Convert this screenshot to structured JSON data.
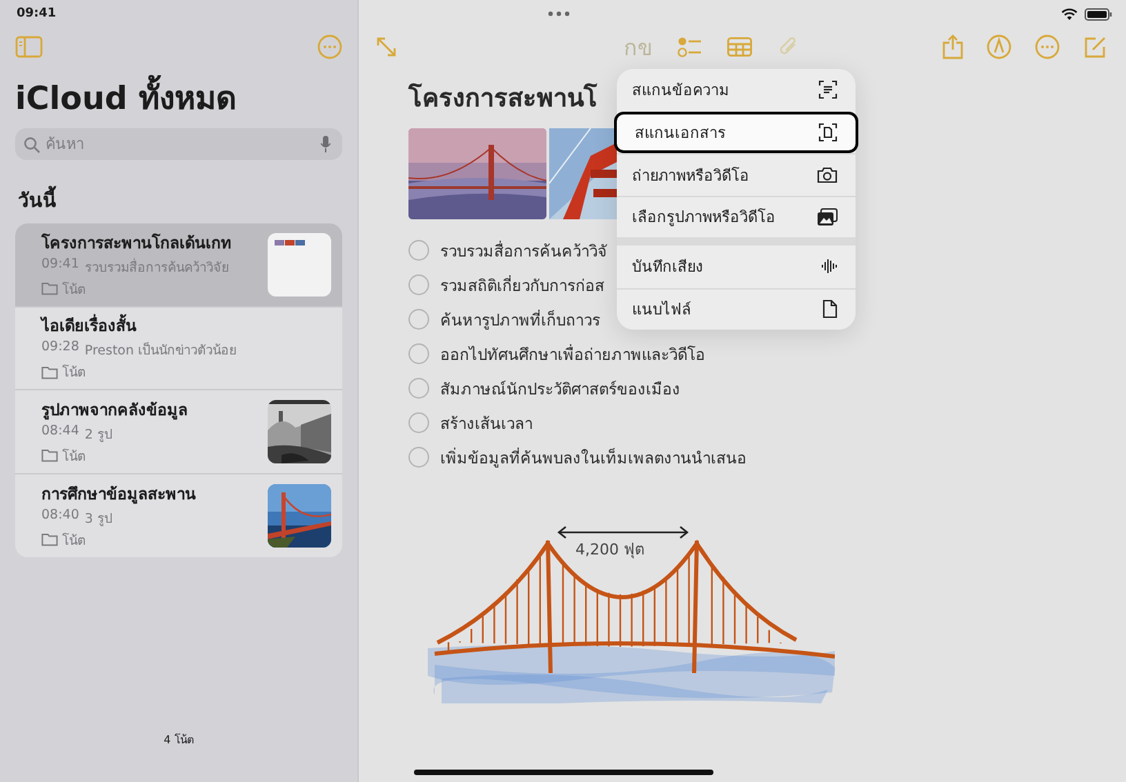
{
  "status_bar": {
    "time": "09:41"
  },
  "sidebar": {
    "title": "iCloud ทั้งหมด",
    "search": {
      "placeholder": "ค้นหา"
    },
    "section": "วันนี้",
    "notes": [
      {
        "title": "โครงการสะพานโกลเด้นเกท",
        "time": "09:41",
        "preview": "รวบรวมสื่อการค้นคว้าวิจัย",
        "folder": "โน้ต",
        "selected": true,
        "kind": "picture"
      },
      {
        "title": "ไอเดียเรื่องสั้น",
        "time": "09:28",
        "preview": "Preston เป็นนักข่าวตัวน้อย",
        "folder": "โน้ต",
        "selected": false,
        "kind": "text"
      },
      {
        "title": "รูปภาพจากคลังข้อมูล",
        "time": "08:44",
        "preview": "2 รูป",
        "folder": "โน้ต",
        "selected": false,
        "kind": "picture"
      },
      {
        "title": "การศึกษาข้อมูลสะพาน",
        "time": "08:40",
        "preview": "3 รูป",
        "folder": "โน้ต",
        "selected": false,
        "kind": "picture"
      }
    ],
    "footer": "4 โน้ต"
  },
  "toolbar": {
    "format_label": "กข"
  },
  "note": {
    "title": "โครงการสะพานโ",
    "checklist": [
      {
        "text": "รวบรวมสื่อการค้นคว้าวิจั",
        "checked": false
      },
      {
        "text": "รวมสถิติเกี่ยวกับการก่อส",
        "checked": false
      },
      {
        "text": "ค้นหารูปภาพที่เก็บถาวร",
        "checked": false
      },
      {
        "text": "ออกไปทัศนศึกษาเพื่อถ่ายภาพและวิดีโอ",
        "checked": false
      },
      {
        "text": "สัมภาษณ์นักประวัติศาสตร์ของเมือง",
        "checked": false
      },
      {
        "text": "สร้างเส้นเวลา",
        "checked": false
      },
      {
        "text": "เพิ่มข้อมูลที่ค้นพบลงในเท็มเพลตงานนำเสนอ",
        "checked": false
      }
    ],
    "drawing_label": "4,200 ฟุต"
  },
  "attach_menu": {
    "groups": [
      [
        {
          "label": "สแกนข้อความ",
          "kind": "scantext",
          "selected": false
        },
        {
          "label": "สแกนเอกสาร",
          "kind": "scandoc",
          "selected": true
        },
        {
          "label": "ถ่ายภาพหรือวิดีโอ",
          "kind": "camera",
          "selected": false
        },
        {
          "label": "เลือกรูปภาพหรือวิดีโอ",
          "kind": "photos",
          "selected": false
        }
      ],
      [
        {
          "label": "บันทึกเสียง",
          "kind": "audio",
          "selected": false
        },
        {
          "label": "แนบไฟล์",
          "kind": "file",
          "selected": false
        }
      ]
    ]
  }
}
